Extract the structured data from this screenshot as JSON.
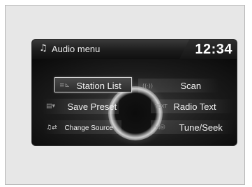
{
  "header": {
    "title": "Audio menu",
    "title_icon": "music-note-icon",
    "clock": "12:34"
  },
  "menu": {
    "station_list": {
      "label": "Station List",
      "icon": "station-list-icon",
      "selected": true
    },
    "save_preset": {
      "label": "Save Preset",
      "icon": "save-preset-icon"
    },
    "change_source": {
      "label": "Change Source",
      "icon": "change-source-icon"
    },
    "scan": {
      "label": "Scan",
      "icon": "scan-icon"
    },
    "radio_text": {
      "label": "Radio Text",
      "icon": "radio-text-icon"
    },
    "tune_seek": {
      "label": "Tune/Seek",
      "icon": "tune-seek-icon"
    }
  },
  "colors": {
    "screen_bg": "#0d0d0d",
    "text": "#f2f2f2",
    "frame_bg": "#e7e7e7"
  }
}
